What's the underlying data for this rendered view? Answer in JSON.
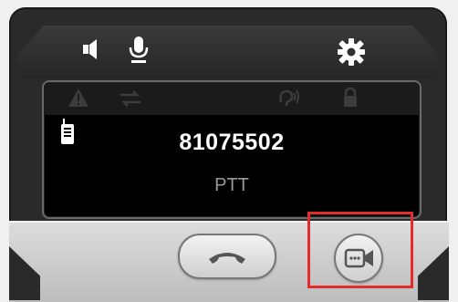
{
  "screen": {
    "caller_number": "81075502",
    "call_mode": "PTT"
  },
  "icons": {
    "speaker": "speaker-icon",
    "microphone": "microphone-icon",
    "settings": "gear-icon",
    "warning": "warning-icon",
    "transfer": "transfer-icon",
    "ear": "ear-icon",
    "lock": "lock-icon",
    "radio": "walkie-talkie-icon",
    "hangup": "hangup-icon",
    "video": "video-camera-icon"
  },
  "colors": {
    "highlight": "#e52b2b",
    "screen_text": "#ffffff",
    "mode_text": "#9a9a9a"
  }
}
